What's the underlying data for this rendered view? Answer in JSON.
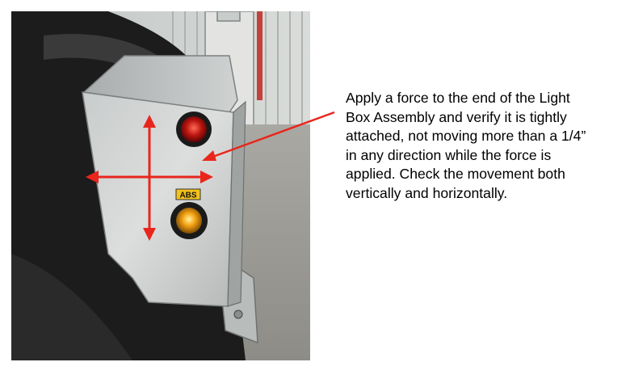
{
  "photo": {
    "badge_text": "ABS"
  },
  "instruction": {
    "text": "Apply a force to the end of the Light\nBox Assembly and verify it is tightly\nattached, not moving more than a 1/4”\nin any direction while the force is\napplied. Check the movement both\nvertically and horizontally."
  },
  "colors": {
    "arrow": "#e8261c",
    "text": "#000000",
    "background": "#ffffff"
  }
}
